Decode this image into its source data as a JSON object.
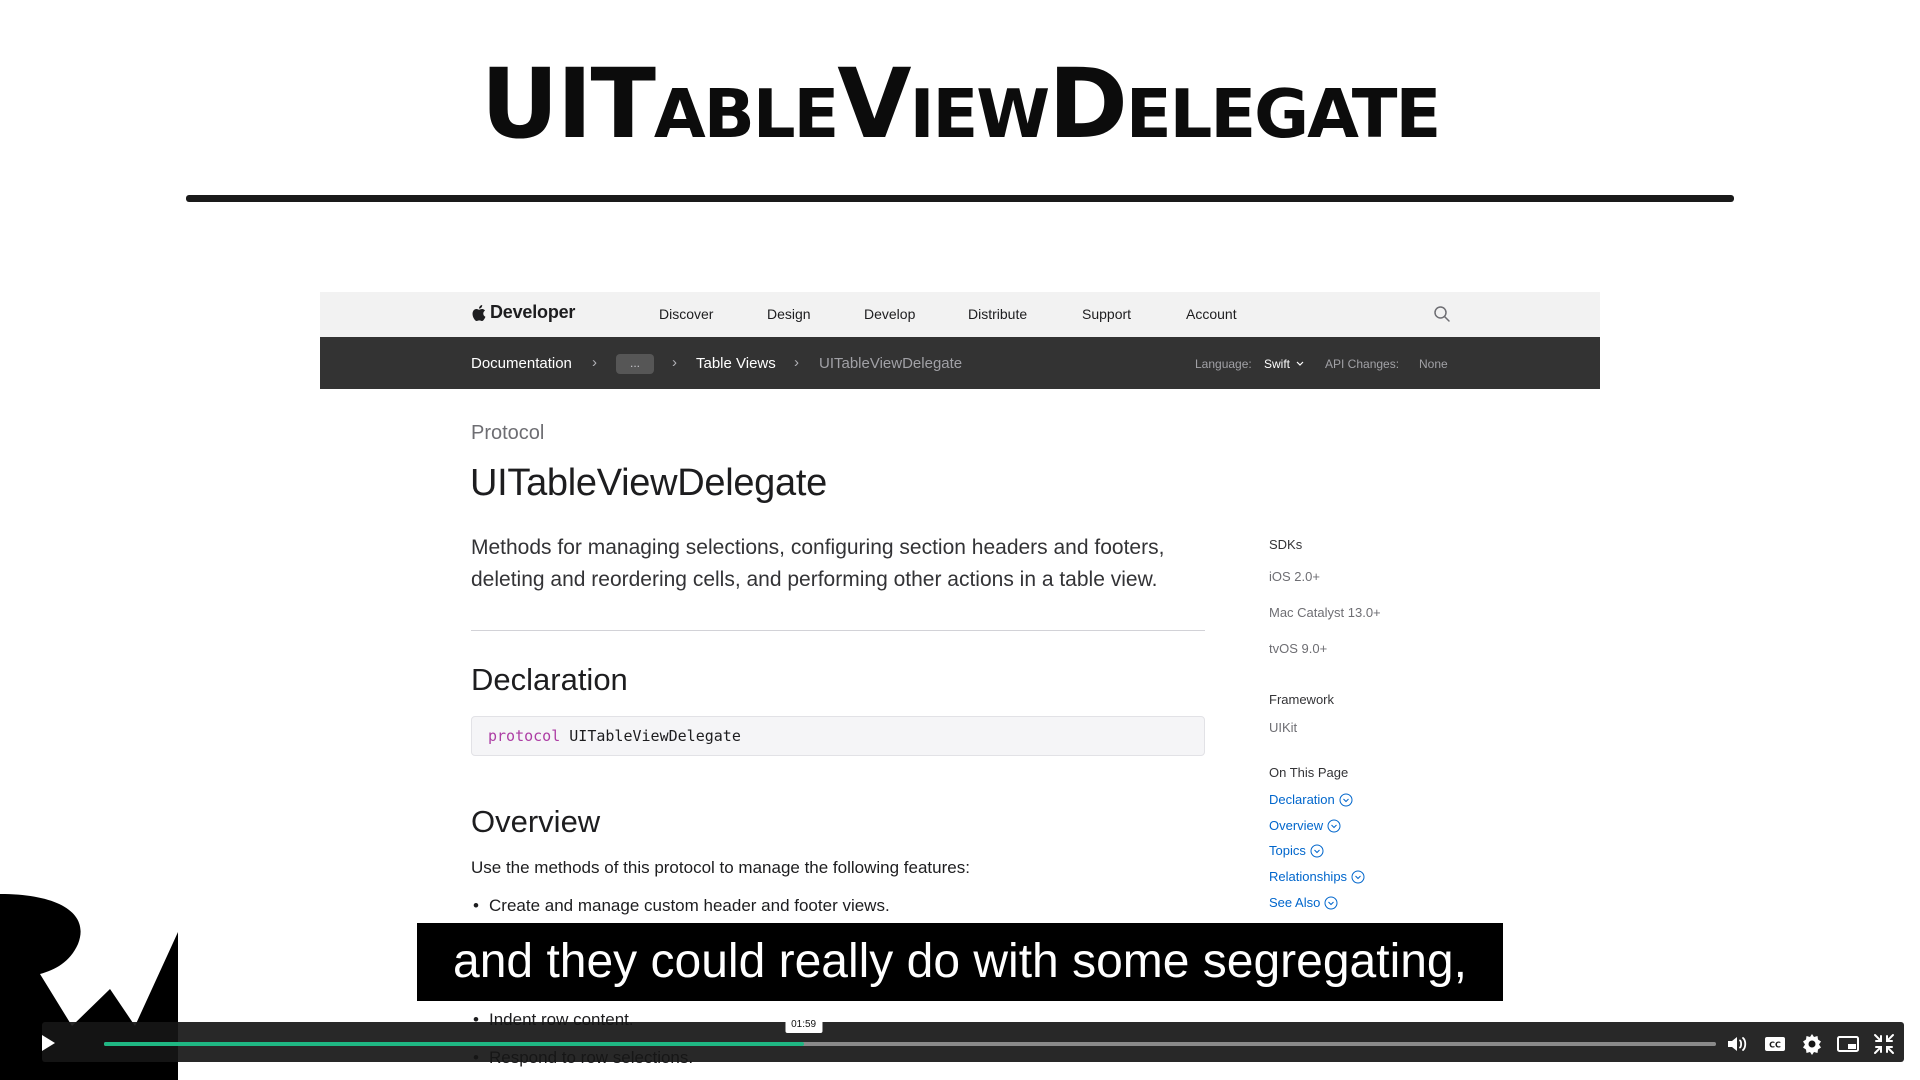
{
  "slide": {
    "title": "UITableViewDelegate"
  },
  "global_nav": {
    "brand": "Developer",
    "items": [
      "Discover",
      "Design",
      "Develop",
      "Distribute",
      "Support",
      "Account"
    ]
  },
  "local_nav": {
    "breadcrumbs": [
      "Documentation",
      "...",
      "Table Views",
      "UITableViewDelegate"
    ],
    "language_label": "Language:",
    "language_value": "Swift",
    "api_changes_label": "API Changes:",
    "api_changes_value": "None"
  },
  "content": {
    "eyebrow": "Protocol",
    "title": "UITableViewDelegate",
    "abstract_line1": "Methods for managing selections, configuring section headers and footers,",
    "abstract_line2": "deleting and reordering cells, and performing other actions in a table view.",
    "declaration_heading": "Declaration",
    "code_keyword": "protocol",
    "code_type": "UITableViewDelegate",
    "overview_heading": "Overview",
    "overview_text": "Use the methods of this protocol to manage the following features:",
    "bullets": [
      "Create and manage custom header and footer views.",
      "Indent row content.",
      "Respond to row selections."
    ]
  },
  "sidebar": {
    "sdks_label": "SDKs",
    "sdks": [
      "iOS 2.0+",
      "Mac Catalyst 13.0+",
      "tvOS 9.0+"
    ],
    "framework_label": "Framework",
    "framework": "UIKit",
    "on_this_page_label": "On This Page",
    "links": [
      "Declaration",
      "Overview",
      "Topics",
      "Relationships",
      "See Also"
    ]
  },
  "video": {
    "caption": "and they could really do with some segregating,",
    "current_time": "01:59",
    "progress": 0.434,
    "buffered": 1.0,
    "accent_color": "#1fb783"
  },
  "colors": {
    "link": "#0066cc",
    "code_keyword": "#ad3da4",
    "localnav_bg": "#333333"
  }
}
